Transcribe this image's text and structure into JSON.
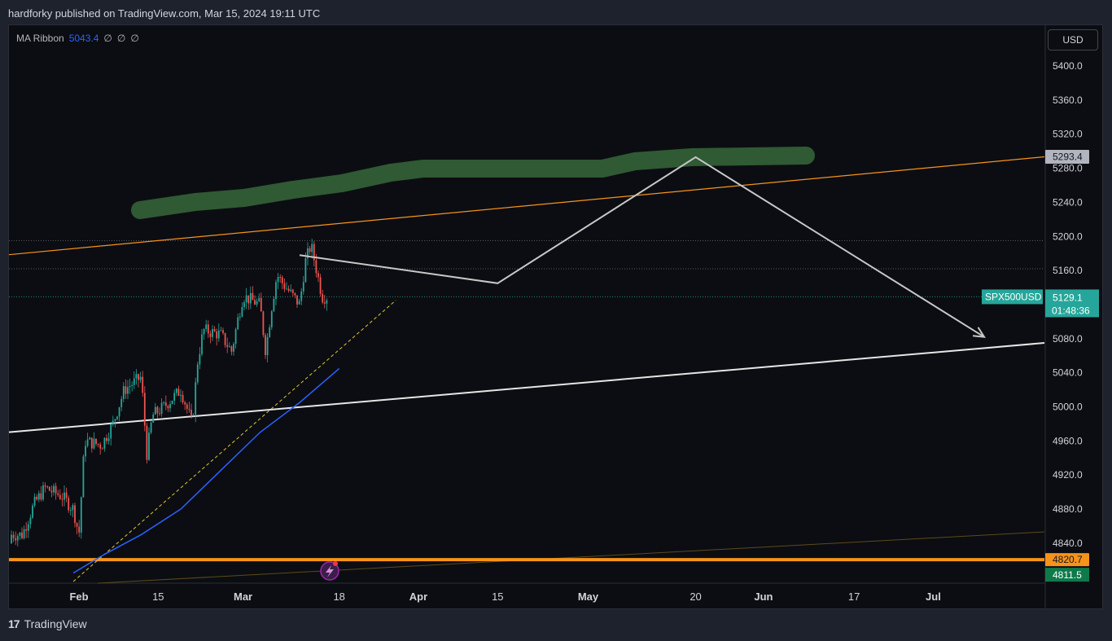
{
  "header": {
    "text": "hardforky published on TradingView.com, Mar 15, 2024 19:11 UTC"
  },
  "legend": {
    "name": "MA Ribbon",
    "value": "5043.4",
    "placeholders": [
      "∅",
      "∅",
      "∅"
    ]
  },
  "currency": "USD",
  "footer": {
    "brand": "TradingView",
    "logo": "17"
  },
  "icons": {
    "lightning": "lightning-icon"
  },
  "colors": {
    "background": "#0c0d12",
    "bull": "#26a69a",
    "bear": "#ef5350",
    "ma": "#2962ff",
    "orange": "#f7931a",
    "green_brush": "#2f5a33",
    "price_tag": "#26a69a"
  },
  "chart_data": {
    "type": "candlestick",
    "symbol": "SPX500USD",
    "y_axis": {
      "min": 4790,
      "max": 5440,
      "ticks": [
        "5400.0",
        "5360.0",
        "5320.0",
        "5280.0",
        "5240.0",
        "5200.0",
        "5160.0",
        "5080.0",
        "5040.0",
        "5000.0",
        "4960.0",
        "4920.0",
        "4880.0",
        "4840.0"
      ]
    },
    "x_axis": {
      "ticks": [
        {
          "label": "Feb",
          "date": "2024-02-01",
          "major": true
        },
        {
          "label": "15",
          "date": "2024-02-15",
          "major": false
        },
        {
          "label": "Mar",
          "date": "2024-03-01",
          "major": true
        },
        {
          "label": "18",
          "date": "2024-03-18",
          "major": false
        },
        {
          "label": "Apr",
          "date": "2024-04-01",
          "major": true
        },
        {
          "label": "15",
          "date": "2024-04-15",
          "major": false
        },
        {
          "label": "May",
          "date": "2024-05-01",
          "major": true
        },
        {
          "label": "20",
          "date": "2024-05-20",
          "major": false
        },
        {
          "label": "Jun",
          "date": "2024-06-01",
          "major": true
        },
        {
          "label": "17",
          "date": "2024-06-17",
          "major": false
        },
        {
          "label": "Jul",
          "date": "2024-07-01",
          "major": true
        }
      ]
    },
    "price_path": [
      [
        "2024-01-22",
        4850
      ],
      [
        "2024-01-24",
        4885
      ],
      [
        "2024-01-26",
        4905
      ],
      [
        "2024-01-29",
        4895
      ],
      [
        "2024-01-31",
        4880
      ],
      [
        "2024-02-01",
        4850
      ],
      [
        "2024-02-02",
        4960
      ],
      [
        "2024-02-05",
        4955
      ],
      [
        "2024-02-07",
        4980
      ],
      [
        "2024-02-09",
        5020
      ],
      [
        "2024-02-12",
        5035
      ],
      [
        "2024-02-13",
        4945
      ],
      [
        "2024-02-14",
        4990
      ],
      [
        "2024-02-16",
        5000
      ],
      [
        "2024-02-19",
        5020
      ],
      [
        "2024-02-21",
        4980
      ],
      [
        "2024-02-22",
        5055
      ],
      [
        "2024-02-23",
        5090
      ],
      [
        "2024-02-26",
        5085
      ],
      [
        "2024-02-28",
        5065
      ],
      [
        "2024-02-29",
        5100
      ],
      [
        "2024-03-01",
        5130
      ],
      [
        "2024-03-04",
        5120
      ],
      [
        "2024-03-05",
        5065
      ],
      [
        "2024-03-06",
        5115
      ],
      [
        "2024-03-07",
        5155
      ],
      [
        "2024-03-08",
        5145
      ],
      [
        "2024-03-11",
        5120
      ],
      [
        "2024-03-12",
        5170
      ],
      [
        "2024-03-13",
        5190
      ],
      [
        "2024-03-14",
        5160
      ],
      [
        "2024-03-15",
        5129.1
      ]
    ],
    "current_price": {
      "label": "SPX500USD",
      "value": "5129.1",
      "countdown": "01:48:36"
    },
    "price_labels": [
      {
        "value": "5293.4",
        "style": "gray"
      },
      {
        "value": "4820.7",
        "style": "orange"
      },
      {
        "value": "4811.5",
        "style": "green"
      }
    ],
    "ma_line": [
      [
        "2024-01-31",
        4805
      ],
      [
        "2024-02-05",
        4825
      ],
      [
        "2024-02-12",
        4850
      ],
      [
        "2024-02-19",
        4880
      ],
      [
        "2024-02-26",
        4925
      ],
      [
        "2024-03-04",
        4970
      ],
      [
        "2024-03-11",
        5005
      ],
      [
        "2024-03-18",
        5045
      ]
    ],
    "dashed_trend": [
      [
        "2024-01-31",
        4795
      ],
      [
        "2024-03-28",
        5125
      ]
    ],
    "resistance_line": [
      [
        "2024-01-20",
        5190
      ],
      [
        "2024-07-24",
        5293.4
      ]
    ],
    "support_line": [
      [
        "2024-01-20",
        4975
      ],
      [
        "2024-07-24",
        5075
      ]
    ],
    "horizontal_levels": [
      5195,
      5162,
      5129.1
    ],
    "orange_level": 4820.7,
    "projection": [
      [
        "2024-03-11",
        5178
      ],
      [
        "2024-04-15",
        5145
      ],
      [
        "2024-05-20",
        5293
      ],
      [
        "2024-07-10",
        5082
      ]
    ]
  }
}
